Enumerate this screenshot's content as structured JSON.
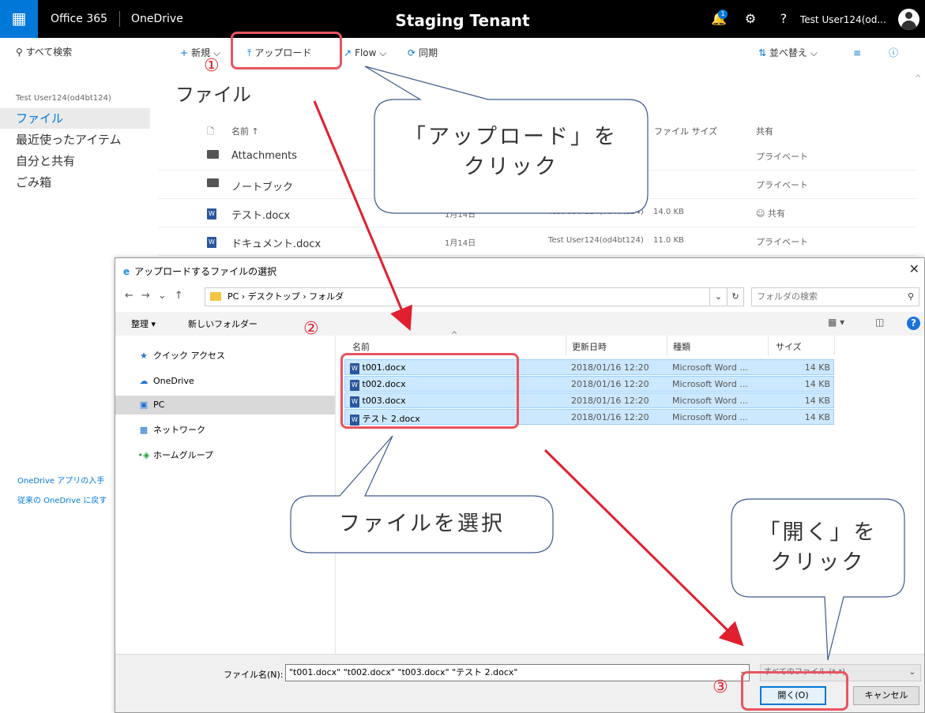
{
  "suitebar": {
    "waffle_icon": "app-launcher-icon",
    "brand": "Office 365",
    "app": "OneDrive",
    "tenant": "Staging Tenant",
    "notification_count": "1",
    "help": "?",
    "user": "Test User124(od...",
    "accent": "#0078d7"
  },
  "leftnav": {
    "search": "すべて検索",
    "user": "Test User124(od4bt124)",
    "items": [
      "ファイル",
      "最近使ったアイテム",
      "自分と共有",
      "ごみ箱"
    ],
    "links": [
      "OneDrive アプリの入手",
      "従来の OneDrive に戻す"
    ]
  },
  "commandbar": {
    "new": "新規",
    "upload": "アップロード",
    "flow": "Flow",
    "sync": "同期",
    "sort": "並べ替え"
  },
  "files": {
    "title": "ファイル",
    "columns": {
      "name": "名前 ↑",
      "size": "ファイル サイズ",
      "sharing": "共有"
    },
    "rows": [
      {
        "name": "Attachments",
        "modified": "",
        "modified_by": "",
        "size": "",
        "sharing": "プライベート"
      },
      {
        "name": "ノートブック",
        "modified": "",
        "modified_by": "",
        "size": "",
        "sharing": "プライベート"
      },
      {
        "name": "テスト.docx",
        "modified": "1月14日",
        "modified_by": "Test User124(od4bt124)",
        "size": "14.0 KB",
        "sharing": "共有"
      },
      {
        "name": "ドキュメント.docx",
        "modified": "1月14日",
        "modified_by": "Test User124(od4bt124)",
        "size": "11.0 KB",
        "sharing": "プライベート"
      }
    ]
  },
  "dialog": {
    "title": "アップロードするファイルの選択",
    "address": "PC  ›  デスクトップ  ›  フォルダ",
    "search_placeholder": "フォルダの検索",
    "organize": "整理 ▾",
    "new_folder": "新しいフォルダー",
    "tree": [
      "クイック アクセス",
      "OneDrive",
      "PC",
      "ネットワーク",
      "ホームグループ"
    ],
    "columns": {
      "name": "名前",
      "modified": "更新日時",
      "type": "種類",
      "size": "サイズ"
    },
    "files": [
      {
        "name": "t001.docx",
        "modified": "2018/01/16 12:20",
        "type": "Microsoft Word ...",
        "size": "14 KB"
      },
      {
        "name": "t002.docx",
        "modified": "2018/01/16 12:20",
        "type": "Microsoft Word ...",
        "size": "14 KB"
      },
      {
        "name": "t003.docx",
        "modified": "2018/01/16 12:20",
        "type": "Microsoft Word ...",
        "size": "14 KB"
      },
      {
        "name": "テスト 2.docx",
        "modified": "2018/01/16 12:20",
        "type": "Microsoft Word ...",
        "size": "14 KB"
      }
    ],
    "filename_label": "ファイル名(N):",
    "filename_value": "\"t001.docx\" \"t002.docx\" \"t003.docx\" \"テスト 2.docx\"",
    "filetype": "すべてのファイル (*.*)",
    "open": "開く(O)",
    "cancel": "キャンセル"
  },
  "annotations": {
    "step1": "①",
    "step2": "②",
    "step3": "③",
    "callout_upload_line1": "「アップロード」を",
    "callout_upload_line2": "クリック",
    "callout_select": "ファイルを選択",
    "callout_open_line1": "「開く」を",
    "callout_open_line2": "クリック",
    "highlight_color": "#e8555f",
    "arrow_color": "#e0202f"
  }
}
